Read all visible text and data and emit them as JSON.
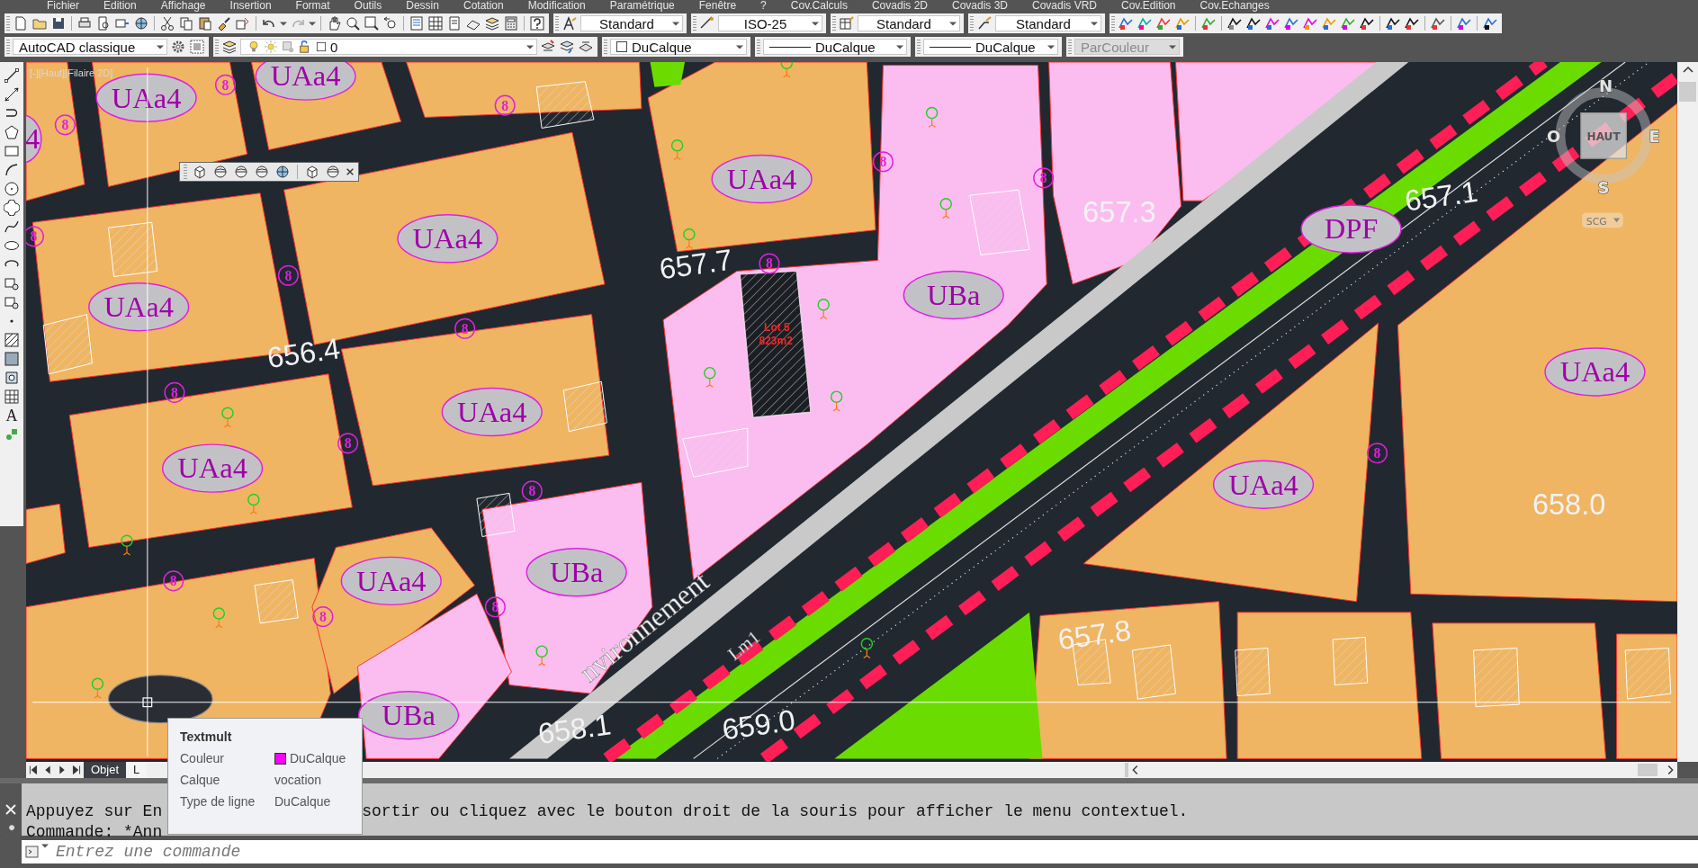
{
  "menu_bar": [
    "Fichier",
    "Edition",
    "Affichage",
    "Insertion",
    "Format",
    "Outils",
    "Dessin",
    "Cotation",
    "Modification",
    "Paramétrique",
    "Fenêtre",
    "?",
    "Cov.Calculs",
    "Covadis 2D",
    "Covadis 3D",
    "Covadis VRD",
    "Cov.Edition",
    "Cov.Echanges"
  ],
  "style_controls": [
    {
      "kind": "text_style",
      "value": "Standard"
    },
    {
      "kind": "dim_style",
      "value": "ISO-25"
    },
    {
      "kind": "table_style",
      "value": "Standard"
    },
    {
      "kind": "mleader_style",
      "value": "Standard"
    }
  ],
  "workspace": {
    "value": "AutoCAD classique"
  },
  "layer_control": {
    "value": "0"
  },
  "properties_bar": [
    {
      "kind": "color",
      "value": "DuCalque",
      "disabled": false
    },
    {
      "kind": "linetype",
      "value": "DuCalque",
      "disabled": false
    },
    {
      "kind": "lineweight",
      "value": "DuCalque",
      "disabled": false
    },
    {
      "kind": "plot_style",
      "value": "ParCouleur",
      "disabled": true
    }
  ],
  "draw_toolbar": {
    "text_tool": "A"
  },
  "viewport": {
    "label": "[-][Haut][Filaire 2D]",
    "zone_labels": [
      "UAa4",
      "UAa4",
      "4",
      "UAa4",
      "DPF",
      "UAa4",
      "UBa",
      "UAa4",
      "UAa4",
      "UAa4",
      "UAa4",
      "UAa4",
      "UBa",
      "UAa4",
      "UBa"
    ],
    "lot_markers": [
      "8",
      "8",
      "8",
      "8",
      "8",
      "8",
      "8",
      "8",
      "8",
      "8",
      "8",
      "8",
      "8",
      "8",
      "8",
      "8"
    ],
    "elevations": [
      "656.4",
      "657.7",
      "657.3",
      "657.1",
      "658.0",
      "657.8",
      "658.1",
      "659.0"
    ],
    "annotations": [
      {
        "kind": "lot",
        "text": "Lot 5"
      },
      {
        "kind": "lot",
        "text": "823m2"
      },
      {
        "kind": "road",
        "text": "nvironnement"
      },
      {
        "kind": "road",
        "text": "Lm1"
      }
    ],
    "viewcube": {
      "face": "HAUT",
      "north": "N",
      "south": "S",
      "east": "E",
      "west": "O",
      "ucs": "SCG"
    }
  },
  "layout_tabs": [
    {
      "label": "Objet",
      "selected": true
    },
    {
      "label": "L",
      "selected": false
    }
  ],
  "tooltip": {
    "title": "Textmult",
    "rows": [
      {
        "label": "Couleur",
        "value": "DuCalque",
        "color": "#ff00ff"
      },
      {
        "label": "Calque",
        "value": "vocation"
      },
      {
        "label": "Type de ligne",
        "value": "DuCalque"
      }
    ]
  },
  "command_line": {
    "history": [
      {
        "parts": [
          "Appuyez sur En",
          "sortir ou cliquez avec le bouton droit de la souris pour afficher le menu contextuel."
        ]
      },
      {
        "parts": [
          "Commande: *Ann"
        ]
      }
    ],
    "placeholder": "Entrez une commande"
  }
}
